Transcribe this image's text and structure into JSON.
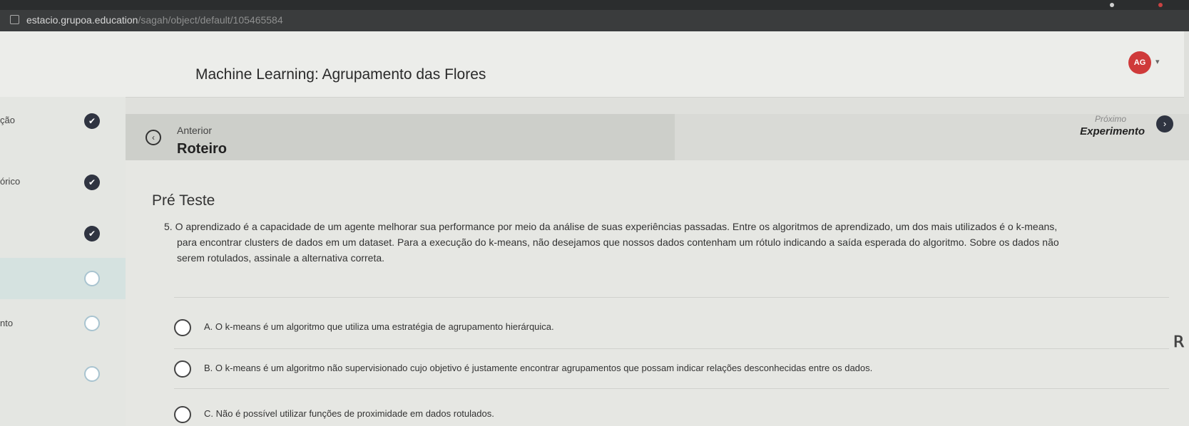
{
  "browser": {
    "url_domain": "estacio.grupoa.education",
    "url_path": "/sagah/object/default/105465584"
  },
  "header": {
    "title": "Machine Learning: Agrupamento das Flores",
    "avatar_initials": "AG"
  },
  "sidebar": {
    "items": [
      {
        "label": "ção",
        "status": "done"
      },
      {
        "label": "órico",
        "status": "done"
      },
      {
        "label": "",
        "status": "done"
      },
      {
        "label": "",
        "status": "pending"
      },
      {
        "label": "nto",
        "status": "pending"
      },
      {
        "label": "",
        "status": "pending"
      }
    ]
  },
  "nav": {
    "prev_small": "Anterior",
    "prev_big": "Roteiro",
    "next_small": "Próximo",
    "next_big": "Experimento"
  },
  "content": {
    "section_title": "Pré Teste",
    "question_lines": [
      "5. O aprendizado é a capacidade de um agente melhorar sua performance por meio da análise de suas experiências passadas. Entre os algoritmos de aprendizado, um dos mais utilizados é o k-means,",
      "para encontrar clusters de dados em um dataset. Para a execução do k-means, não desejamos que nossos dados contenham um rótulo indicando a saída esperada do algoritmo. Sobre os dados não",
      "serem rotulados, assinale a alternativa correta."
    ],
    "options": [
      "A. O k-means é um algoritmo que utiliza uma estratégia de agrupamento hierárquica.",
      "B. O k-means é um algoritmo não supervisionado cujo objetivo é justamente encontrar agrupamentos que possam indicar relações desconhecidas entre os dados.",
      "C. Não é possível utilizar funções de proximidade em dados rotulados."
    ]
  },
  "colors": {
    "accent_dark": "#2f3441",
    "avatar": "#cf3a3a",
    "sidebar_active": "#d5e2e0"
  }
}
